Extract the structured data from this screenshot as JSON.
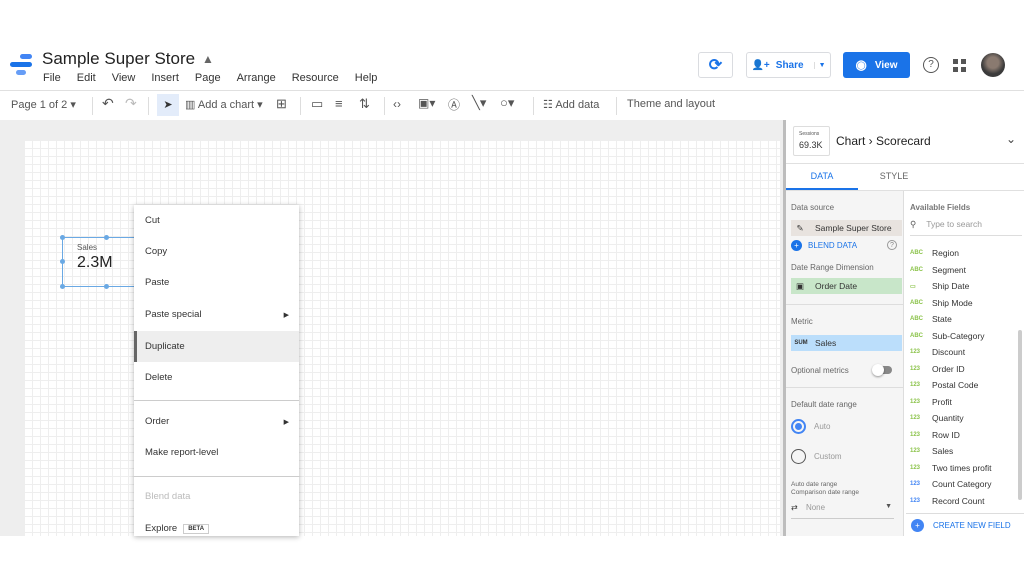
{
  "header": {
    "title": "Sample Super Store",
    "menu": [
      "File",
      "Edit",
      "View",
      "Insert",
      "Page",
      "Arrange",
      "Resource",
      "Help"
    ],
    "share": "Share",
    "view": "View"
  },
  "toolbar": {
    "page": "Page 1 of 2",
    "add_chart": "Add a chart",
    "add_data": "Add data",
    "theme": "Theme and layout"
  },
  "scorecard": {
    "label": "Sales",
    "value": "2.3M"
  },
  "context_menu": {
    "items": [
      "Cut",
      "Copy",
      "Paste",
      "Paste special",
      "Duplicate",
      "Delete",
      "Order",
      "Make report-level",
      "Blend data",
      "Explore"
    ],
    "beta": "BETA"
  },
  "panel": {
    "thumb_label": "Sessions",
    "thumb_value": "69.3K",
    "crumb1": "Chart",
    "crumb2": "Scorecard",
    "tabs": [
      "DATA",
      "STYLE"
    ],
    "data_source_label": "Data source",
    "data_source": "Sample Super Store",
    "blend": "BLEND DATA",
    "date_dim_label": "Date Range Dimension",
    "date_dim": "Order Date",
    "metric_label": "Metric",
    "metric_agg": "SUM",
    "metric": "Sales",
    "optional": "Optional metrics",
    "date_range_label": "Default date range",
    "auto": "Auto",
    "custom": "Custom",
    "auto_range": "Auto date range",
    "comparison": "Comparison date range",
    "none": "None",
    "fields_label": "Available Fields",
    "search_placeholder": "Type to search",
    "fields": [
      {
        "t": "ABC",
        "n": "Region"
      },
      {
        "t": "ABC",
        "n": "Segment"
      },
      {
        "t": "DATE",
        "n": "Ship Date"
      },
      {
        "t": "ABC",
        "n": "Ship Mode"
      },
      {
        "t": "ABC",
        "n": "State"
      },
      {
        "t": "ABC",
        "n": "Sub-Category"
      },
      {
        "t": "123",
        "n": "Discount"
      },
      {
        "t": "123",
        "n": "Order ID"
      },
      {
        "t": "123",
        "n": "Postal Code"
      },
      {
        "t": "123",
        "n": "Profit"
      },
      {
        "t": "123",
        "n": "Quantity"
      },
      {
        "t": "123",
        "n": "Row ID"
      },
      {
        "t": "123",
        "n": "Sales"
      },
      {
        "t": "123",
        "n": "Two times profit"
      },
      {
        "t": "123",
        "n": "Count Category"
      },
      {
        "t": "123",
        "n": "Record Count"
      }
    ],
    "create": "CREATE NEW FIELD"
  },
  "colors": {
    "accent": "#1a73e8",
    "date_chip": "#c8e6c9",
    "metric_chip": "#bbdefb"
  }
}
